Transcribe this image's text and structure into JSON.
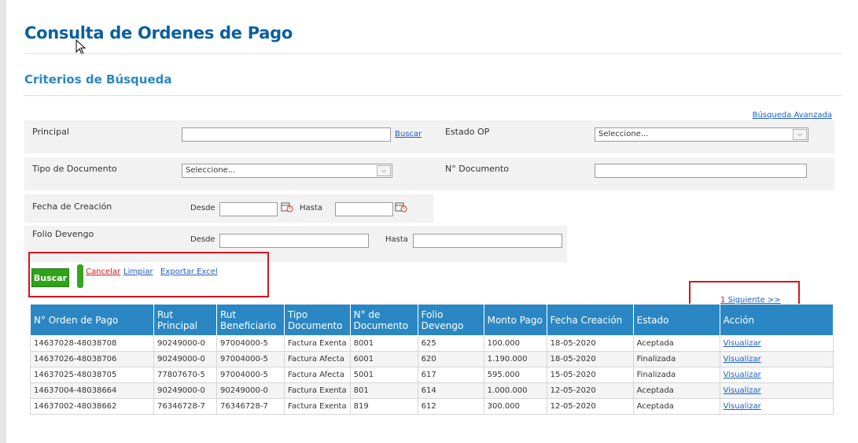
{
  "page": {
    "title": "Consulta de Ordenes de Pago",
    "section_title": "Criterios de Búsqueda",
    "advanced_search": "Búsqueda Avanzada"
  },
  "form": {
    "principal": {
      "label": "Principal",
      "value": "",
      "search_link": "Buscar"
    },
    "estado_op": {
      "label": "Estado OP",
      "selected": "Seleccione..."
    },
    "tipo_documento": {
      "label": "Tipo de Documento",
      "selected": "Seleccione..."
    },
    "n_documento": {
      "label": "N° Documento",
      "value": ""
    },
    "fecha_creacion": {
      "label": "Fecha de Creación",
      "desde_label": "Desde",
      "hasta_label": "Hasta",
      "desde_value": "",
      "hasta_value": ""
    },
    "folio_devengo": {
      "label": "Folio Devengo",
      "desde_label": "Desde",
      "hasta_label": "Hasta",
      "desde_value": "",
      "hasta_value": ""
    }
  },
  "actions": {
    "buscar": "Buscar",
    "cancelar": "Cancelar",
    "limpiar": "Limpiar",
    "exportar": "Exportar Excel"
  },
  "pager": {
    "page": "1",
    "next": "Siguiente >>"
  },
  "table": {
    "headers": [
      "N° Orden de Pago",
      "Rut Principal",
      "Rut Beneficiario",
      "Tipo Documento",
      "N° de Documento",
      "Folio Devengo",
      "Monto Pago",
      "Fecha Creación",
      "Estado",
      "Acción"
    ],
    "rows": [
      [
        "14637028-48038708",
        "90249000-0",
        "97004000-5",
        "Factura Exenta",
        "8001",
        "625",
        "100.000",
        "18-05-2020",
        "Aceptada",
        "Visualizar"
      ],
      [
        "14637026-48038706",
        "90249000-0",
        "97004000-5",
        "Factura Afecta",
        "6001",
        "620",
        "1.190.000",
        "18-05-2020",
        "Finalizada",
        "Visualizar"
      ],
      [
        "14637025-48038705",
        "77807670-5",
        "97004000-5",
        "Factura Afecta",
        "5001",
        "617",
        "595.000",
        "15-05-2020",
        "Finalizada",
        "Visualizar"
      ],
      [
        "14637004-48038664",
        "90249000-0",
        "90249000-0",
        "Factura Exenta",
        "801",
        "614",
        "1.000.000",
        "12-05-2020",
        "Aceptada",
        "Visualizar"
      ],
      [
        "14637002-48038662",
        "76346728-7",
        "76346728-7",
        "Factura Exenta",
        "819",
        "612",
        "300.000",
        "12-05-2020",
        "Aceptada",
        "Visualizar"
      ]
    ]
  },
  "colors": {
    "accent": "#2a87c4",
    "title": "#0a5f9e",
    "button": "#2ea318",
    "highlight": "#d9141b"
  }
}
